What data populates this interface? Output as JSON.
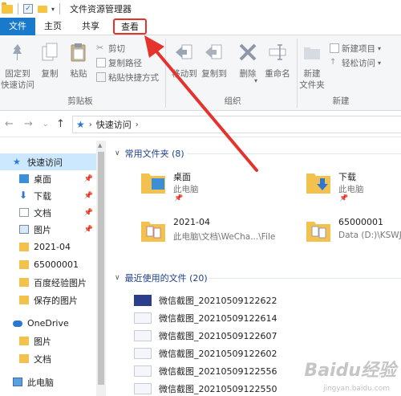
{
  "window": {
    "title": "文件资源管理器"
  },
  "tabs": {
    "file": "文件",
    "home": "主页",
    "share": "共享",
    "view": "查看"
  },
  "ribbon": {
    "pin_quick_access": [
      "固定到",
      "快速访问"
    ],
    "copy": "复制",
    "paste": "粘贴",
    "cut": "剪切",
    "copy_path": "复制路径",
    "paste_shortcut": "粘贴快捷方式",
    "move_to": "移动到",
    "copy_to": "复制到",
    "delete": "删除",
    "rename": "重命名",
    "new_folder": [
      "新建",
      "文件夹"
    ],
    "new_item": "新建项目",
    "easy_access": "轻松访问",
    "groups": {
      "clipboard": "剪贴板",
      "organize": "组织",
      "new": "新建"
    }
  },
  "address": {
    "location": "快速访问"
  },
  "sidebar": {
    "items": [
      {
        "label": "快速访问",
        "icon": "star-icon",
        "pinned": false,
        "selected": true
      },
      {
        "label": "桌面",
        "icon": "desktop-icon",
        "pinned": true
      },
      {
        "label": "下载",
        "icon": "download-icon",
        "pinned": true
      },
      {
        "label": "文档",
        "icon": "document-icon",
        "pinned": true
      },
      {
        "label": "图片",
        "icon": "picture-icon",
        "pinned": true
      },
      {
        "label": "2021-04",
        "icon": "folder-icon",
        "pinned": false
      },
      {
        "label": "65000001",
        "icon": "folder-icon",
        "pinned": false
      },
      {
        "label": "百度经验图片",
        "icon": "folder-icon",
        "pinned": false
      },
      {
        "label": "保存的图片",
        "icon": "folder-icon",
        "pinned": false
      },
      {
        "label": "OneDrive",
        "icon": "cloud-icon",
        "pinned": false
      },
      {
        "label": "图片",
        "icon": "folder-icon",
        "pinned": false
      },
      {
        "label": "文档",
        "icon": "folder-icon",
        "pinned": false
      },
      {
        "label": "此电脑",
        "icon": "computer-icon",
        "pinned": false
      }
    ]
  },
  "frequent": {
    "header": "常用文件夹 (8)",
    "folders": [
      {
        "name": "桌面",
        "sub": "此电脑"
      },
      {
        "name": "下载",
        "sub": "此电脑"
      },
      {
        "name": "2021-04",
        "sub": "此电脑\\文档\\WeCha...\\File"
      },
      {
        "name": "65000001",
        "sub": "Data (D:)\\KSWJ"
      }
    ]
  },
  "recent": {
    "header": "最近使用的文件 (20)",
    "files": [
      "微信截图_20210509122622",
      "微信截图_20210509122614",
      "微信截图_20210509122607",
      "微信截图_20210509122602",
      "微信截图_20210509122556",
      "微信截图_20210509122550"
    ]
  },
  "colors": {
    "accent": "#1979ca",
    "highlight": "#e5322d",
    "selected": "#cce8ff"
  },
  "watermark": {
    "text": "Baidu经验",
    "sub": "jingyan.baidu.com"
  }
}
